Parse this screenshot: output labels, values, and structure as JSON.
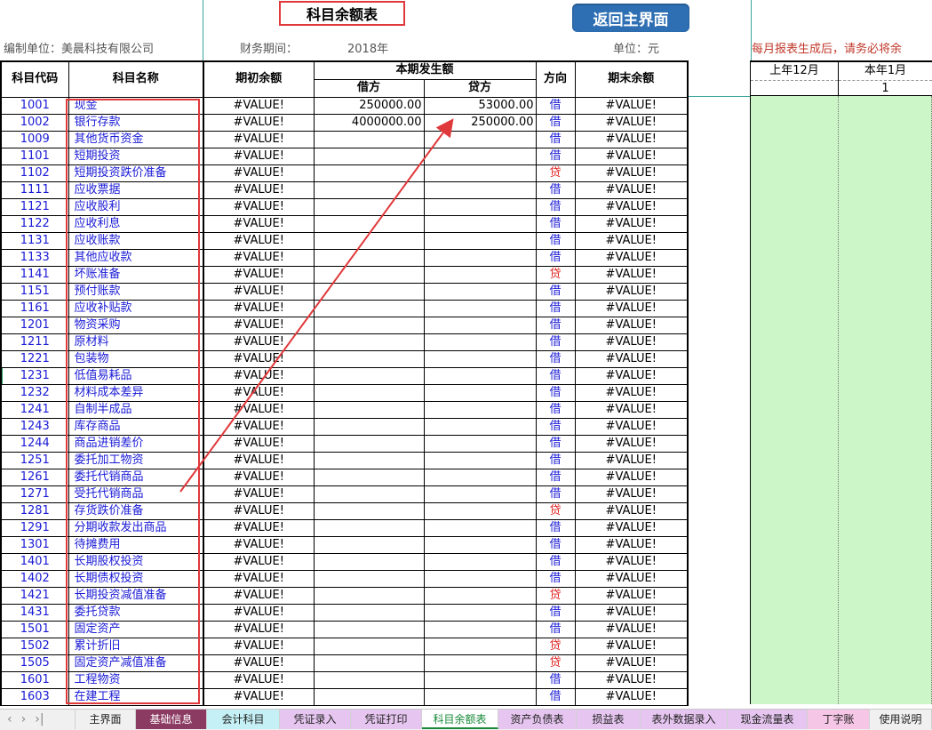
{
  "sheet": {
    "title": "科目余额表",
    "return_button": "返回主界面",
    "company_label": "编制单位：美晨科技有限公司",
    "period_label": "财务期间：",
    "period_value": "2018年",
    "unit_label": "单位：元",
    "notice": "每月报表生成后，请务必将余"
  },
  "table": {
    "headers": {
      "code": "科目代码",
      "name": "科目名称",
      "opening": "期初余额",
      "current": "本期发生额",
      "debit": "借方",
      "credit": "贷方",
      "direction": "方向",
      "ending": "期末余额"
    },
    "rows": [
      {
        "code": "1001",
        "name": "现金",
        "opening": "#VALUE!",
        "debit": "250000.00",
        "credit": "53000.00",
        "dir": "借",
        "ending": "#VALUE!"
      },
      {
        "code": "1002",
        "name": "银行存款",
        "opening": "#VALUE!",
        "debit": "4000000.00",
        "credit": "250000.00",
        "dir": "借",
        "ending": "#VALUE!"
      },
      {
        "code": "1009",
        "name": "其他货币资金",
        "opening": "#VALUE!",
        "debit": "",
        "credit": "",
        "dir": "借",
        "ending": "#VALUE!"
      },
      {
        "code": "1101",
        "name": "短期投资",
        "opening": "#VALUE!",
        "debit": "",
        "credit": "",
        "dir": "借",
        "ending": "#VALUE!"
      },
      {
        "code": "1102",
        "name": "短期投资跌价准备",
        "opening": "#VALUE!",
        "debit": "",
        "credit": "",
        "dir": "贷",
        "ending": "#VALUE!"
      },
      {
        "code": "1111",
        "name": "应收票据",
        "opening": "#VALUE!",
        "debit": "",
        "credit": "",
        "dir": "借",
        "ending": "#VALUE!"
      },
      {
        "code": "1121",
        "name": "应收股利",
        "opening": "#VALUE!",
        "debit": "",
        "credit": "",
        "dir": "借",
        "ending": "#VALUE!"
      },
      {
        "code": "1122",
        "name": "应收利息",
        "opening": "#VALUE!",
        "debit": "",
        "credit": "",
        "dir": "借",
        "ending": "#VALUE!"
      },
      {
        "code": "1131",
        "name": "应收账款",
        "opening": "#VALUE!",
        "debit": "",
        "credit": "",
        "dir": "借",
        "ending": "#VALUE!"
      },
      {
        "code": "1133",
        "name": "其他应收款",
        "opening": "#VALUE!",
        "debit": "",
        "credit": "",
        "dir": "借",
        "ending": "#VALUE!"
      },
      {
        "code": "1141",
        "name": "坏账准备",
        "opening": "#VALUE!",
        "debit": "",
        "credit": "",
        "dir": "贷",
        "ending": "#VALUE!"
      },
      {
        "code": "1151",
        "name": "预付账款",
        "opening": "#VALUE!",
        "debit": "",
        "credit": "",
        "dir": "借",
        "ending": "#VALUE!"
      },
      {
        "code": "1161",
        "name": "应收补贴款",
        "opening": "#VALUE!",
        "debit": "",
        "credit": "",
        "dir": "借",
        "ending": "#VALUE!"
      },
      {
        "code": "1201",
        "name": "物资采购",
        "opening": "#VALUE!",
        "debit": "",
        "credit": "",
        "dir": "借",
        "ending": "#VALUE!"
      },
      {
        "code": "1211",
        "name": "原材料",
        "opening": "#VALUE!",
        "debit": "",
        "credit": "",
        "dir": "借",
        "ending": "#VALUE!"
      },
      {
        "code": "1221",
        "name": "包装物",
        "opening": "#VALUE!",
        "debit": "",
        "credit": "",
        "dir": "借",
        "ending": "#VALUE!"
      },
      {
        "code": "1231",
        "name": "低值易耗品",
        "opening": "#VALUE!",
        "debit": "",
        "credit": "",
        "dir": "借",
        "ending": "#VALUE!"
      },
      {
        "code": "1232",
        "name": "材料成本差异",
        "opening": "#VALUE!",
        "debit": "",
        "credit": "",
        "dir": "借",
        "ending": "#VALUE!"
      },
      {
        "code": "1241",
        "name": "自制半成品",
        "opening": "#VALUE!",
        "debit": "",
        "credit": "",
        "dir": "借",
        "ending": "#VALUE!"
      },
      {
        "code": "1243",
        "name": "库存商品",
        "opening": "#VALUE!",
        "debit": "",
        "credit": "",
        "dir": "借",
        "ending": "#VALUE!"
      },
      {
        "code": "1244",
        "name": "商品进销差价",
        "opening": "#VALUE!",
        "debit": "",
        "credit": "",
        "dir": "借",
        "ending": "#VALUE!"
      },
      {
        "code": "1251",
        "name": "委托加工物资",
        "opening": "#VALUE!",
        "debit": "",
        "credit": "",
        "dir": "借",
        "ending": "#VALUE!"
      },
      {
        "code": "1261",
        "name": "委托代销商品",
        "opening": "#VALUE!",
        "debit": "",
        "credit": "",
        "dir": "借",
        "ending": "#VALUE!"
      },
      {
        "code": "1271",
        "name": "受托代销商品",
        "opening": "#VALUE!",
        "debit": "",
        "credit": "",
        "dir": "借",
        "ending": "#VALUE!"
      },
      {
        "code": "1281",
        "name": "存货跌价准备",
        "opening": "#VALUE!",
        "debit": "",
        "credit": "",
        "dir": "贷",
        "ending": "#VALUE!"
      },
      {
        "code": "1291",
        "name": "分期收款发出商品",
        "opening": "#VALUE!",
        "debit": "",
        "credit": "",
        "dir": "借",
        "ending": "#VALUE!"
      },
      {
        "code": "1301",
        "name": "待摊费用",
        "opening": "#VALUE!",
        "debit": "",
        "credit": "",
        "dir": "借",
        "ending": "#VALUE!"
      },
      {
        "code": "1401",
        "name": "长期股权投资",
        "opening": "#VALUE!",
        "debit": "",
        "credit": "",
        "dir": "借",
        "ending": "#VALUE!"
      },
      {
        "code": "1402",
        "name": "长期债权投资",
        "opening": "#VALUE!",
        "debit": "",
        "credit": "",
        "dir": "借",
        "ending": "#VALUE!"
      },
      {
        "code": "1421",
        "name": "长期投资减值准备",
        "opening": "#VALUE!",
        "debit": "",
        "credit": "",
        "dir": "贷",
        "ending": "#VALUE!"
      },
      {
        "code": "1431",
        "name": "委托贷款",
        "opening": "#VALUE!",
        "debit": "",
        "credit": "",
        "dir": "借",
        "ending": "#VALUE!"
      },
      {
        "code": "1501",
        "name": "固定资产",
        "opening": "#VALUE!",
        "debit": "",
        "credit": "",
        "dir": "借",
        "ending": "#VALUE!"
      },
      {
        "code": "1502",
        "name": "累计折旧",
        "opening": "#VALUE!",
        "debit": "",
        "credit": "",
        "dir": "贷",
        "ending": "#VALUE!"
      },
      {
        "code": "1505",
        "name": "固定资产减值准备",
        "opening": "#VALUE!",
        "debit": "",
        "credit": "",
        "dir": "贷",
        "ending": "#VALUE!"
      },
      {
        "code": "1601",
        "name": "工程物资",
        "opening": "#VALUE!",
        "debit": "",
        "credit": "",
        "dir": "借",
        "ending": "#VALUE!"
      },
      {
        "code": "1603",
        "name": "在建工程",
        "opening": "#VALUE!",
        "debit": "",
        "credit": "",
        "dir": "借",
        "ending": "#VALUE!"
      }
    ]
  },
  "side_panel": {
    "col1": "上年12月",
    "col2": "本年1月",
    "col2_value": "1"
  },
  "tab_nav": [
    "‹",
    "›",
    "›|"
  ],
  "tabs": [
    {
      "label": "主界面",
      "bg": "#f0f0f0",
      "color": "#222",
      "width": 68
    },
    {
      "label": "基础信息",
      "bg": "#8b3a62",
      "color": "#ffffff",
      "width": 80
    },
    {
      "label": "会计科目",
      "bg": "#c5f0f5",
      "color": "#222",
      "width": 82
    },
    {
      "label": "凭证录入",
      "bg": "#e6c6f0",
      "color": "#222",
      "width": 80
    },
    {
      "label": "凭证打印",
      "bg": "#e6c6f0",
      "color": "#222",
      "width": 80
    },
    {
      "label": "科目余额表",
      "bg": "#ffffff",
      "color": "#1a8a3a",
      "width": 86,
      "active": true
    },
    {
      "label": "资产负债表",
      "bg": "#e6c6f0",
      "color": "#222",
      "width": 88
    },
    {
      "label": "损益表",
      "bg": "#e6c6f0",
      "color": "#222",
      "width": 72
    },
    {
      "label": "表外数据录入",
      "bg": "#e6c6f0",
      "color": "#222",
      "width": 98
    },
    {
      "label": "现金流量表",
      "bg": "#e6c6f0",
      "color": "#222",
      "width": 90
    },
    {
      "label": "丁字账",
      "bg": "#f6c6e6",
      "color": "#222",
      "width": 70
    },
    {
      "label": "使用说明",
      "bg": "#f0f0f0",
      "color": "#222",
      "width": 70
    }
  ]
}
